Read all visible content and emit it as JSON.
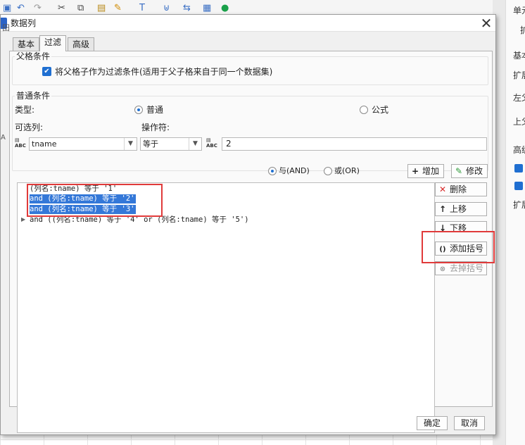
{
  "dialog": {
    "title": "数据列",
    "close_glyph": "✕",
    "tabs": [
      {
        "label": "基本"
      },
      {
        "label": "过滤"
      },
      {
        "label": "高级"
      }
    ]
  },
  "parent_condition": {
    "group_label": "父格条件",
    "checkbox_label": "将父格子作为过滤条件(适用于父子格来自于同一个数据集)"
  },
  "normal_condition": {
    "group_label": "普通条件",
    "type_label": "类型:",
    "type_normal": "普通",
    "type_formula": "公式",
    "column_label": "可选列:",
    "operator_label": "操作符:",
    "column_value": "tname",
    "operator_value": "等于",
    "value_input": "2"
  },
  "logic": {
    "and_label": "与(AND)",
    "or_label": "或(OR)",
    "add_label": "增加",
    "edit_label": "修改"
  },
  "conditions": [
    "(列名:tname) 等于 '1'",
    "and (列名:tname) 等于 '2'",
    "and (列名:tname) 等于 '3'",
    "and ((列名:tname) 等于 '4' or (列名:tname) 等于 '5')"
  ],
  "side_buttons": {
    "delete_label": "删除",
    "up_label": "上移",
    "down_label": "下移",
    "add_paren_label": "添加括号",
    "remove_paren_label": "去掉括号"
  },
  "footer": {
    "ok_label": "确定",
    "cancel_label": "取消"
  },
  "background": {
    "row_label": "田",
    "cell_a": "A",
    "cell_abc": "ABC",
    "right_panel": [
      "单元",
      "扩",
      "基本",
      "扩展",
      "左父",
      "上父",
      "高级",
      "扩展"
    ]
  }
}
